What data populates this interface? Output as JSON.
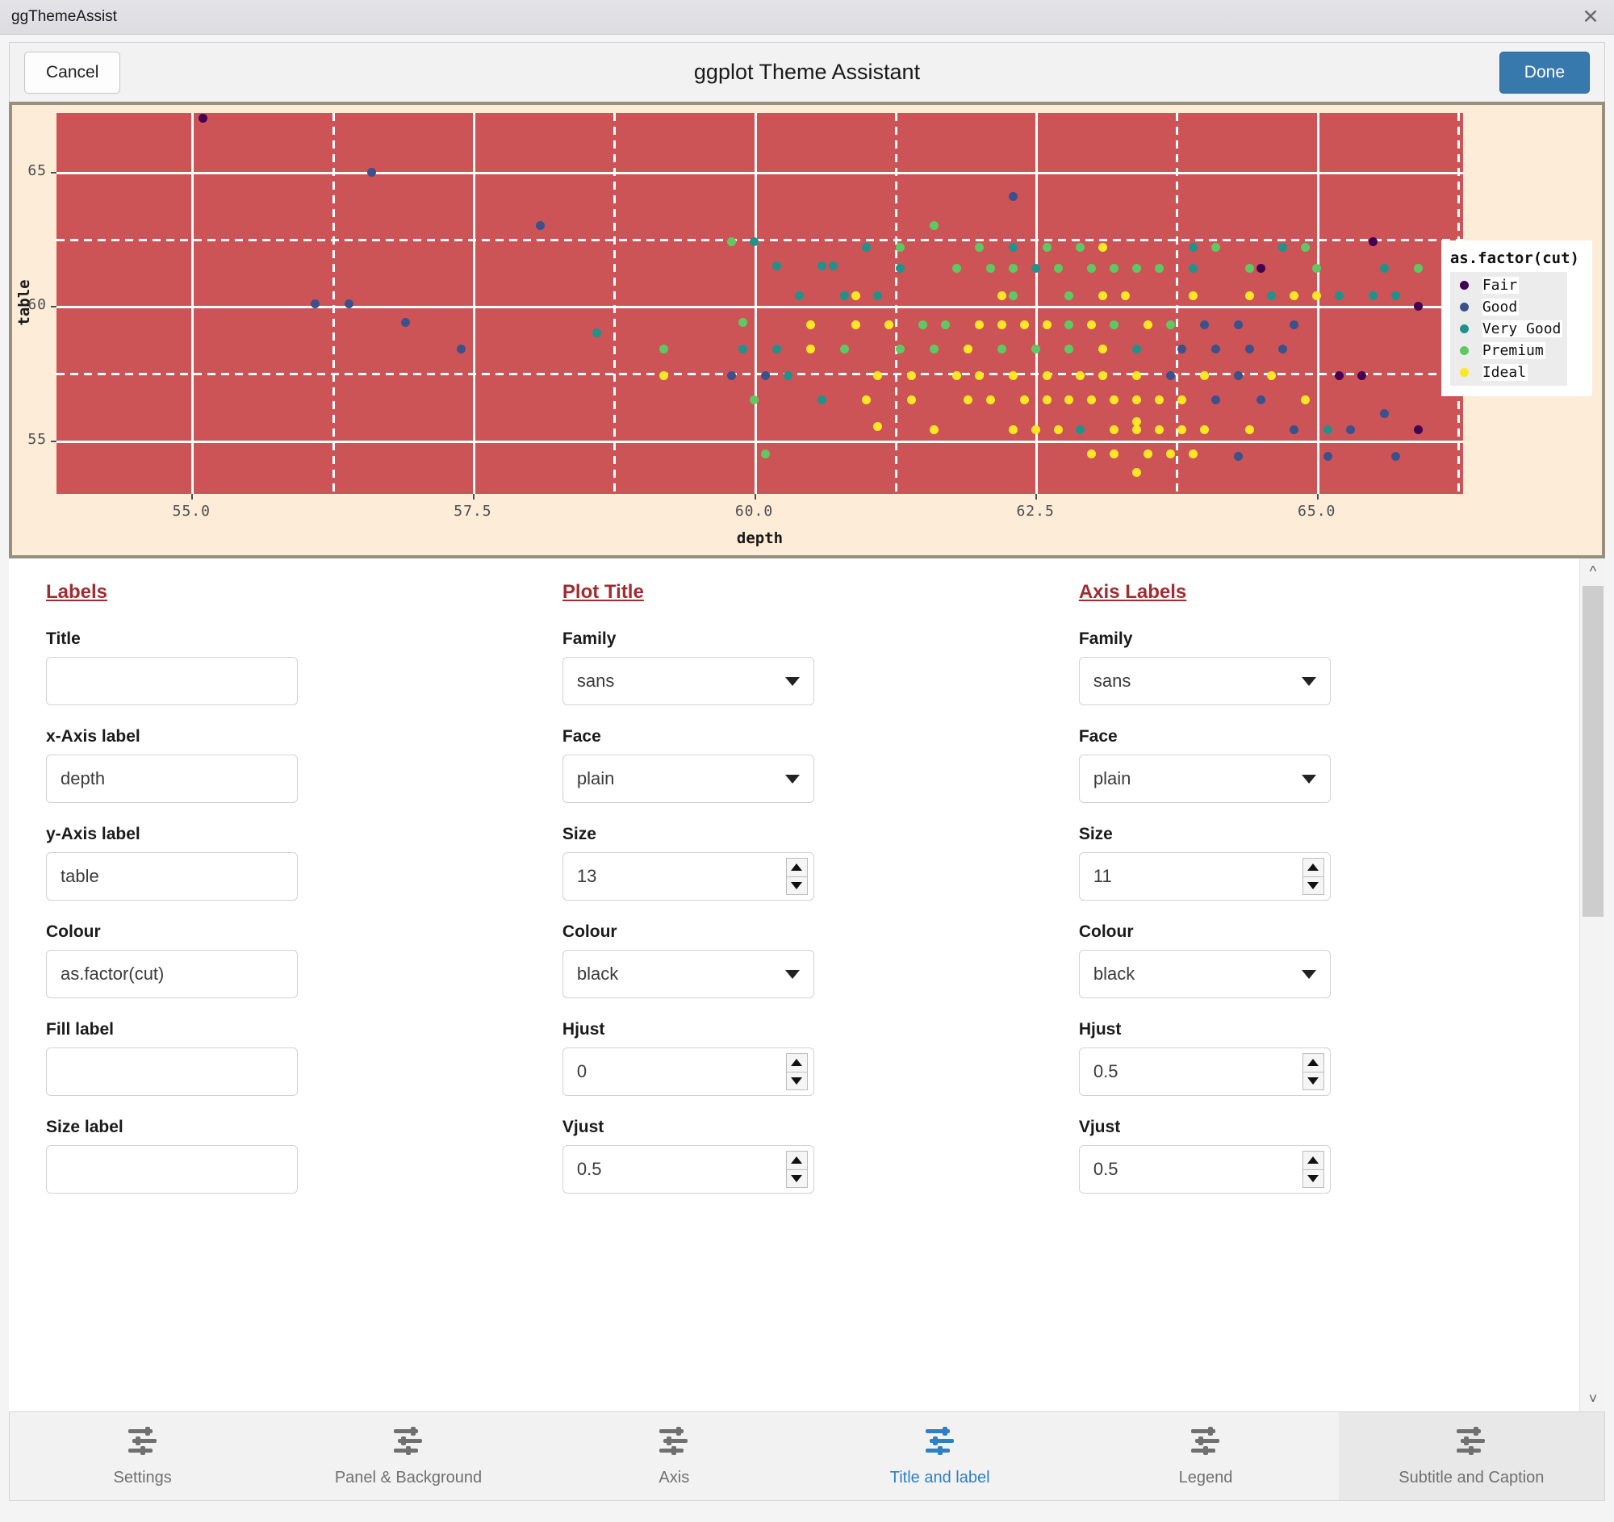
{
  "window": {
    "title": "ggThemeAssist",
    "close_icon": "close-icon"
  },
  "header": {
    "cancel_label": "Cancel",
    "title": "ggplot Theme Assistant",
    "done_label": "Done",
    "done_color": "#3879ad"
  },
  "chart_data": {
    "type": "scatter",
    "title": "",
    "xlabel": "depth",
    "ylabel": "table",
    "xlim": [
      53.8,
      66.3
    ],
    "ylim": [
      53.0,
      67.2
    ],
    "xticks": [
      "55.0",
      "57.5",
      "60.0",
      "62.5",
      "65.0"
    ],
    "xtick_values": [
      55.0,
      57.5,
      60.0,
      62.5,
      65.0
    ],
    "yticks": [
      "65",
      "60",
      "55"
    ],
    "ytick_values": [
      65,
      60,
      55
    ],
    "grid": "major solid white, minor dashed white",
    "panel_background": "#cd5456",
    "plot_background": "#fdecd7",
    "legend_position": "right",
    "legend_title": "as.factor(cut)",
    "legend_entries": [
      {
        "label": "Fair",
        "color": "#440154"
      },
      {
        "label": "Good",
        "color": "#3b518b"
      },
      {
        "label": "Very Good",
        "color": "#21918c"
      },
      {
        "label": "Premium",
        "color": "#5ec962"
      },
      {
        "label": "Ideal",
        "color": "#fde725"
      }
    ],
    "points": [
      {
        "x": 55.1,
        "y": 67.0,
        "g": 0
      },
      {
        "x": 56.6,
        "y": 65.0,
        "g": 1
      },
      {
        "x": 62.3,
        "y": 64.1,
        "g": 1
      },
      {
        "x": 58.1,
        "y": 63.0,
        "g": 1
      },
      {
        "x": 61.6,
        "y": 63.0,
        "g": 3
      },
      {
        "x": 59.8,
        "y": 62.4,
        "g": 3
      },
      {
        "x": 60.0,
        "y": 62.4,
        "g": 2
      },
      {
        "x": 65.5,
        "y": 62.4,
        "g": 0
      },
      {
        "x": 61.0,
        "y": 62.2,
        "g": 2
      },
      {
        "x": 61.3,
        "y": 62.2,
        "g": 2
      },
      {
        "x": 61.3,
        "y": 62.2,
        "g": 3
      },
      {
        "x": 62.0,
        "y": 62.2,
        "g": 3
      },
      {
        "x": 62.3,
        "y": 62.2,
        "g": 2
      },
      {
        "x": 62.6,
        "y": 62.2,
        "g": 3
      },
      {
        "x": 62.9,
        "y": 62.2,
        "g": 3
      },
      {
        "x": 63.1,
        "y": 62.2,
        "g": 4
      },
      {
        "x": 63.9,
        "y": 62.2,
        "g": 2
      },
      {
        "x": 64.1,
        "y": 62.2,
        "g": 3
      },
      {
        "x": 64.7,
        "y": 62.2,
        "g": 2
      },
      {
        "x": 64.9,
        "y": 62.2,
        "g": 3
      },
      {
        "x": 64.5,
        "y": 61.4,
        "g": 0
      },
      {
        "x": 60.2,
        "y": 61.5,
        "g": 2
      },
      {
        "x": 60.6,
        "y": 61.5,
        "g": 2
      },
      {
        "x": 60.7,
        "y": 61.5,
        "g": 2
      },
      {
        "x": 61.3,
        "y": 61.4,
        "g": 2
      },
      {
        "x": 61.8,
        "y": 61.4,
        "g": 3
      },
      {
        "x": 62.1,
        "y": 61.4,
        "g": 3
      },
      {
        "x": 62.3,
        "y": 61.4,
        "g": 3
      },
      {
        "x": 62.5,
        "y": 61.4,
        "g": 2
      },
      {
        "x": 62.7,
        "y": 61.4,
        "g": 3
      },
      {
        "x": 63.0,
        "y": 61.4,
        "g": 3
      },
      {
        "x": 63.2,
        "y": 61.4,
        "g": 3
      },
      {
        "x": 63.4,
        "y": 61.4,
        "g": 3
      },
      {
        "x": 63.6,
        "y": 61.4,
        "g": 3
      },
      {
        "x": 63.9,
        "y": 61.4,
        "g": 2
      },
      {
        "x": 64.4,
        "y": 61.4,
        "g": 3
      },
      {
        "x": 65.0,
        "y": 61.4,
        "g": 3
      },
      {
        "x": 65.6,
        "y": 61.4,
        "g": 2
      },
      {
        "x": 65.9,
        "y": 61.4,
        "g": 3
      },
      {
        "x": 56.1,
        "y": 60.1,
        "g": 1
      },
      {
        "x": 56.4,
        "y": 60.1,
        "g": 1
      },
      {
        "x": 60.4,
        "y": 60.4,
        "g": 2
      },
      {
        "x": 60.8,
        "y": 60.4,
        "g": 2
      },
      {
        "x": 60.9,
        "y": 60.4,
        "g": 4
      },
      {
        "x": 61.1,
        "y": 60.4,
        "g": 2
      },
      {
        "x": 62.2,
        "y": 60.4,
        "g": 4
      },
      {
        "x": 62.3,
        "y": 60.4,
        "g": 3
      },
      {
        "x": 62.8,
        "y": 60.4,
        "g": 3
      },
      {
        "x": 63.1,
        "y": 60.4,
        "g": 4
      },
      {
        "x": 63.3,
        "y": 60.4,
        "g": 4
      },
      {
        "x": 63.9,
        "y": 60.4,
        "g": 4
      },
      {
        "x": 64.4,
        "y": 60.4,
        "g": 4
      },
      {
        "x": 64.6,
        "y": 60.4,
        "g": 2
      },
      {
        "x": 64.8,
        "y": 60.4,
        "g": 4
      },
      {
        "x": 65.0,
        "y": 60.4,
        "g": 4
      },
      {
        "x": 65.2,
        "y": 60.4,
        "g": 2
      },
      {
        "x": 65.5,
        "y": 60.4,
        "g": 2
      },
      {
        "x": 65.7,
        "y": 60.4,
        "g": 2
      },
      {
        "x": 65.9,
        "y": 60.0,
        "g": 0
      },
      {
        "x": 56.9,
        "y": 59.4,
        "g": 1
      },
      {
        "x": 58.6,
        "y": 59.0,
        "g": 2
      },
      {
        "x": 59.9,
        "y": 59.4,
        "g": 3
      },
      {
        "x": 60.5,
        "y": 59.3,
        "g": 4
      },
      {
        "x": 60.9,
        "y": 59.3,
        "g": 4
      },
      {
        "x": 61.2,
        "y": 59.3,
        "g": 4
      },
      {
        "x": 61.5,
        "y": 59.3,
        "g": 3
      },
      {
        "x": 61.7,
        "y": 59.3,
        "g": 3
      },
      {
        "x": 62.0,
        "y": 59.3,
        "g": 4
      },
      {
        "x": 62.2,
        "y": 59.3,
        "g": 4
      },
      {
        "x": 62.4,
        "y": 59.3,
        "g": 4
      },
      {
        "x": 62.6,
        "y": 59.3,
        "g": 4
      },
      {
        "x": 62.8,
        "y": 59.3,
        "g": 3
      },
      {
        "x": 63.0,
        "y": 59.3,
        "g": 4
      },
      {
        "x": 63.2,
        "y": 59.3,
        "g": 3
      },
      {
        "x": 63.5,
        "y": 59.3,
        "g": 4
      },
      {
        "x": 63.7,
        "y": 59.3,
        "g": 3
      },
      {
        "x": 64.0,
        "y": 59.3,
        "g": 1
      },
      {
        "x": 64.3,
        "y": 59.3,
        "g": 1
      },
      {
        "x": 64.8,
        "y": 59.3,
        "g": 1
      },
      {
        "x": 57.4,
        "y": 58.4,
        "g": 1
      },
      {
        "x": 59.2,
        "y": 58.4,
        "g": 3
      },
      {
        "x": 59.9,
        "y": 58.4,
        "g": 2
      },
      {
        "x": 60.2,
        "y": 58.4,
        "g": 2
      },
      {
        "x": 60.5,
        "y": 58.4,
        "g": 4
      },
      {
        "x": 60.8,
        "y": 58.4,
        "g": 3
      },
      {
        "x": 61.3,
        "y": 58.4,
        "g": 3
      },
      {
        "x": 61.6,
        "y": 58.4,
        "g": 3
      },
      {
        "x": 61.9,
        "y": 58.4,
        "g": 4
      },
      {
        "x": 62.2,
        "y": 58.4,
        "g": 3
      },
      {
        "x": 62.5,
        "y": 58.4,
        "g": 3
      },
      {
        "x": 62.8,
        "y": 58.4,
        "g": 3
      },
      {
        "x": 63.1,
        "y": 58.4,
        "g": 4
      },
      {
        "x": 63.4,
        "y": 58.4,
        "g": 2
      },
      {
        "x": 63.8,
        "y": 58.4,
        "g": 1
      },
      {
        "x": 64.1,
        "y": 58.4,
        "g": 1
      },
      {
        "x": 64.4,
        "y": 58.4,
        "g": 1
      },
      {
        "x": 64.7,
        "y": 58.4,
        "g": 1
      },
      {
        "x": 59.2,
        "y": 57.4,
        "g": 4
      },
      {
        "x": 59.8,
        "y": 57.4,
        "g": 1
      },
      {
        "x": 60.1,
        "y": 57.4,
        "g": 1
      },
      {
        "x": 60.3,
        "y": 57.4,
        "g": 2
      },
      {
        "x": 61.1,
        "y": 57.4,
        "g": 4
      },
      {
        "x": 61.4,
        "y": 57.4,
        "g": 4
      },
      {
        "x": 61.8,
        "y": 57.4,
        "g": 4
      },
      {
        "x": 62.0,
        "y": 57.4,
        "g": 4
      },
      {
        "x": 62.3,
        "y": 57.4,
        "g": 4
      },
      {
        "x": 62.6,
        "y": 57.4,
        "g": 4
      },
      {
        "x": 62.9,
        "y": 57.4,
        "g": 4
      },
      {
        "x": 63.1,
        "y": 57.4,
        "g": 4
      },
      {
        "x": 63.4,
        "y": 57.4,
        "g": 4
      },
      {
        "x": 63.7,
        "y": 57.4,
        "g": 1
      },
      {
        "x": 64.0,
        "y": 57.4,
        "g": 4
      },
      {
        "x": 64.3,
        "y": 57.4,
        "g": 1
      },
      {
        "x": 64.6,
        "y": 57.4,
        "g": 4
      },
      {
        "x": 65.2,
        "y": 57.4,
        "g": 0
      },
      {
        "x": 65.4,
        "y": 57.4,
        "g": 0
      },
      {
        "x": 60.0,
        "y": 56.5,
        "g": 3
      },
      {
        "x": 60.6,
        "y": 56.5,
        "g": 2
      },
      {
        "x": 61.0,
        "y": 56.5,
        "g": 4
      },
      {
        "x": 61.4,
        "y": 56.5,
        "g": 4
      },
      {
        "x": 61.9,
        "y": 56.5,
        "g": 4
      },
      {
        "x": 62.1,
        "y": 56.5,
        "g": 4
      },
      {
        "x": 62.4,
        "y": 56.5,
        "g": 4
      },
      {
        "x": 62.6,
        "y": 56.5,
        "g": 4
      },
      {
        "x": 62.8,
        "y": 56.5,
        "g": 4
      },
      {
        "x": 63.0,
        "y": 56.5,
        "g": 4
      },
      {
        "x": 63.2,
        "y": 56.5,
        "g": 4
      },
      {
        "x": 63.4,
        "y": 56.5,
        "g": 4
      },
      {
        "x": 63.6,
        "y": 56.5,
        "g": 4
      },
      {
        "x": 63.8,
        "y": 56.5,
        "g": 4
      },
      {
        "x": 64.1,
        "y": 56.5,
        "g": 1
      },
      {
        "x": 64.5,
        "y": 56.5,
        "g": 1
      },
      {
        "x": 64.9,
        "y": 56.5,
        "g": 4
      },
      {
        "x": 65.6,
        "y": 56.0,
        "g": 1
      },
      {
        "x": 61.1,
        "y": 55.5,
        "g": 4
      },
      {
        "x": 61.6,
        "y": 55.4,
        "g": 4
      },
      {
        "x": 62.3,
        "y": 55.4,
        "g": 4
      },
      {
        "x": 62.5,
        "y": 55.4,
        "g": 4
      },
      {
        "x": 62.7,
        "y": 55.4,
        "g": 4
      },
      {
        "x": 62.9,
        "y": 55.4,
        "g": 2
      },
      {
        "x": 63.2,
        "y": 55.4,
        "g": 4
      },
      {
        "x": 63.4,
        "y": 55.7,
        "g": 4
      },
      {
        "x": 63.4,
        "y": 55.4,
        "g": 4
      },
      {
        "x": 63.6,
        "y": 55.4,
        "g": 4
      },
      {
        "x": 63.8,
        "y": 55.4,
        "g": 4
      },
      {
        "x": 64.0,
        "y": 55.4,
        "g": 4
      },
      {
        "x": 64.4,
        "y": 55.4,
        "g": 4
      },
      {
        "x": 64.8,
        "y": 55.4,
        "g": 1
      },
      {
        "x": 65.1,
        "y": 55.4,
        "g": 2
      },
      {
        "x": 65.3,
        "y": 55.4,
        "g": 1
      },
      {
        "x": 65.9,
        "y": 55.4,
        "g": 0
      },
      {
        "x": 60.1,
        "y": 54.5,
        "g": 3
      },
      {
        "x": 63.0,
        "y": 54.5,
        "g": 4
      },
      {
        "x": 63.2,
        "y": 54.5,
        "g": 4
      },
      {
        "x": 63.5,
        "y": 54.5,
        "g": 4
      },
      {
        "x": 63.7,
        "y": 54.5,
        "g": 4
      },
      {
        "x": 63.9,
        "y": 54.5,
        "g": 4
      },
      {
        "x": 64.3,
        "y": 54.4,
        "g": 1
      },
      {
        "x": 65.1,
        "y": 54.4,
        "g": 1
      },
      {
        "x": 65.7,
        "y": 54.4,
        "g": 1
      },
      {
        "x": 63.4,
        "y": 53.8,
        "g": 4
      }
    ]
  },
  "form": {
    "columns": [
      {
        "heading": "Labels",
        "fields": [
          {
            "type": "text",
            "label": "Title",
            "value": "",
            "name": "title"
          },
          {
            "type": "text",
            "label": "x-Axis label",
            "value": "depth",
            "name": "x-axis-label"
          },
          {
            "type": "text",
            "label": "y-Axis label",
            "value": "table",
            "name": "y-axis-label"
          },
          {
            "type": "text",
            "label": "Colour",
            "value": "as.factor(cut)",
            "name": "colour"
          },
          {
            "type": "text",
            "label": "Fill label",
            "value": "",
            "name": "fill-label"
          },
          {
            "type": "text",
            "label": "Size label",
            "value": "",
            "name": "size-label"
          }
        ]
      },
      {
        "heading": "Plot Title",
        "fields": [
          {
            "type": "select",
            "label": "Family",
            "value": "sans",
            "name": "family"
          },
          {
            "type": "select",
            "label": "Face",
            "value": "plain",
            "name": "face"
          },
          {
            "type": "spin",
            "label": "Size",
            "value": "13",
            "name": "size"
          },
          {
            "type": "select",
            "label": "Colour",
            "value": "black",
            "name": "colour"
          },
          {
            "type": "spin",
            "label": "Hjust",
            "value": "0",
            "name": "hjust"
          },
          {
            "type": "spin",
            "label": "Vjust",
            "value": "0.5",
            "name": "vjust"
          }
        ]
      },
      {
        "heading": "Axis Labels",
        "fields": [
          {
            "type": "select",
            "label": "Family",
            "value": "sans",
            "name": "family"
          },
          {
            "type": "select",
            "label": "Face",
            "value": "plain",
            "name": "face"
          },
          {
            "type": "spin",
            "label": "Size",
            "value": "11",
            "name": "size"
          },
          {
            "type": "select",
            "label": "Colour",
            "value": "black",
            "name": "colour"
          },
          {
            "type": "spin",
            "label": "Hjust",
            "value": "0.5",
            "name": "hjust"
          },
          {
            "type": "spin",
            "label": "Vjust",
            "value": "0.5",
            "name": "vjust"
          }
        ]
      }
    ]
  },
  "tabs": [
    {
      "label": "Settings",
      "icon": "sliders-icon",
      "state": "normal"
    },
    {
      "label": "Panel & Background",
      "icon": "sliders-icon",
      "state": "normal"
    },
    {
      "label": "Axis",
      "icon": "sliders-icon",
      "state": "normal"
    },
    {
      "label": "Title and label",
      "icon": "sliders-icon",
      "state": "active"
    },
    {
      "label": "Legend",
      "icon": "sliders-icon",
      "state": "normal"
    },
    {
      "label": "Subtitle and Caption",
      "icon": "sliders-icon",
      "state": "hover"
    }
  ]
}
